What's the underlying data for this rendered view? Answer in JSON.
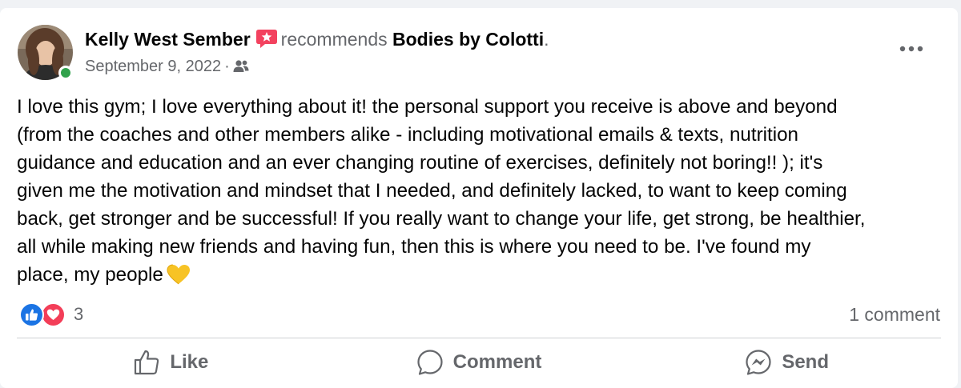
{
  "post": {
    "author": "Kelly West Sember",
    "recommends_word": "recommends",
    "page_name": "Bodies by Colotti",
    "period": ".",
    "date": "September 9, 2022",
    "separator": "·",
    "audience_icon": "friends-icon",
    "body": "I love this gym; I love everything about it! the personal support you receive is above and beyond\n(from the coaches and other members alike - including motivational  emails & texts, nutrition\nguidance and education and an ever changing routine of exercises, definitely not boring!! ); it's\ngiven me the motivation and mindset that I needed, and definitely lacked, to want to keep coming\nback, get stronger and be successful! If you really want to change your life, get strong, be healthier,\nall while making new friends and having fun, then this is where you need to be. I've found my\nplace, my people",
    "emoji": "yellow-heart-icon"
  },
  "stats": {
    "reaction_icons": [
      "like-icon",
      "love-icon"
    ],
    "reaction_count": "3",
    "comment_count": "1 comment"
  },
  "actions": {
    "like": "Like",
    "comment": "Comment",
    "send": "Send"
  },
  "colors": {
    "like_blue": "#1b74e4",
    "love_red": "#f33e58",
    "online_green": "#31a24c",
    "secondary_text": "#65676b",
    "recommend_pink": "#f3425f"
  }
}
